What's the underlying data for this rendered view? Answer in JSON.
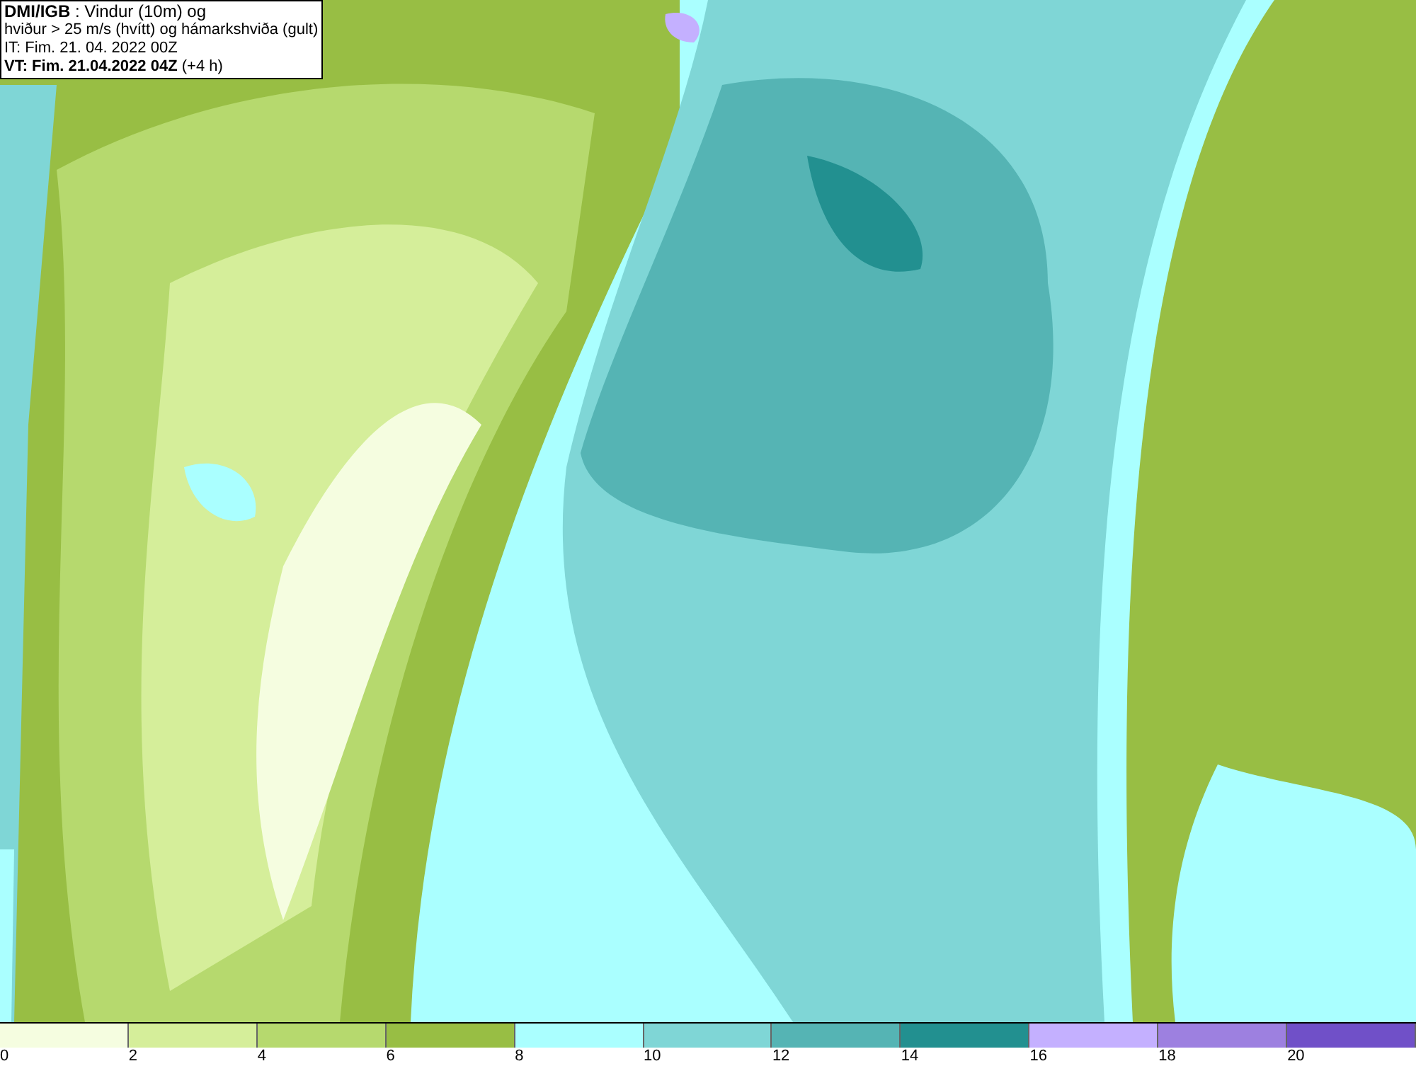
{
  "header": {
    "lines": [
      "**DMI/IGB** : Vindur (10m) og",
      "hviður > 25 m/s (hvítt) og hámarkshviða (gult)",
      "IT: Fim. 21. 04. 2022 00Z",
      "**VT: Fim. 21.04.2022 04Z** (+4 h)"
    ]
  },
  "legend": {
    "bins": [
      {
        "label": "0",
        "color": "#f5fde0"
      },
      {
        "label": "2",
        "color": "#d5ee9a"
      },
      {
        "label": "4",
        "color": "#b6d96e"
      },
      {
        "label": "6",
        "color": "#98be44"
      },
      {
        "label": "8",
        "color": "#aaffff"
      },
      {
        "label": "10",
        "color": "#7fd6d6"
      },
      {
        "label": "12",
        "color": "#55b4b4"
      },
      {
        "label": "14",
        "color": "#229090"
      },
      {
        "label": "16",
        "color": "#c4b0ff"
      },
      {
        "label": "18",
        "color": "#9d80e0"
      },
      {
        "label": "20",
        "color": "#7050c8"
      }
    ]
  }
}
